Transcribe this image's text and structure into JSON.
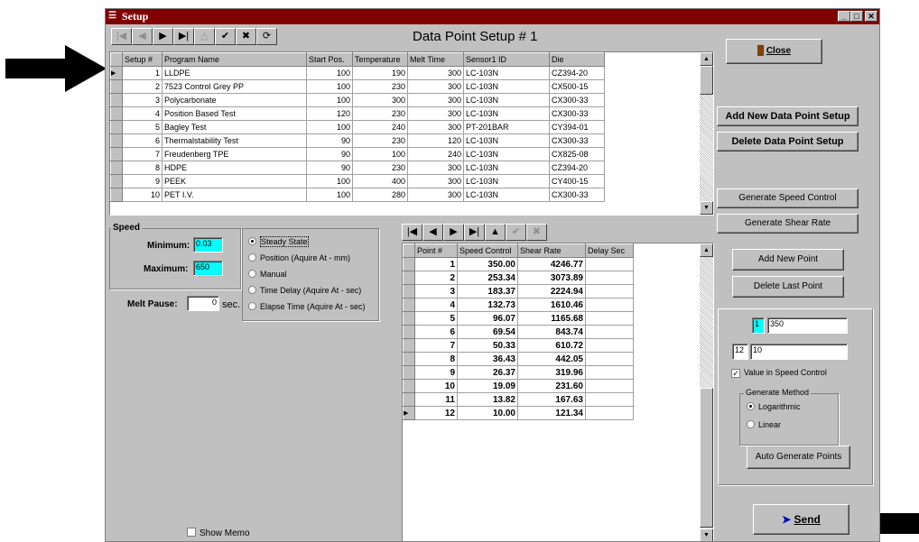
{
  "window": {
    "title": "Setup",
    "form_title": "Data Point Setup # 1"
  },
  "setup_grid": {
    "columns": [
      "Setup #",
      "Program Name",
      "Start Pos.",
      "Temperature",
      "Melt Time",
      "Sensor1 ID",
      "Die"
    ],
    "rows": [
      [
        "1",
        "LLDPE",
        "100",
        "190",
        "300",
        "LC-103N",
        "CZ394-20"
      ],
      [
        "2",
        "7523 Control Grey PP",
        "100",
        "230",
        "300",
        "LC-103N",
        "CX500-15"
      ],
      [
        "3",
        "Polycarbonate",
        "100",
        "300",
        "300",
        "LC-103N",
        "CX300-33"
      ],
      [
        "4",
        "Position Based Test",
        "120",
        "230",
        "300",
        "LC-103N",
        "CX300-33"
      ],
      [
        "5",
        "Bagley Test",
        "100",
        "240",
        "300",
        "PT-201BAR",
        "CY394-01"
      ],
      [
        "6",
        "Thermalstability Test",
        "90",
        "230",
        "120",
        "LC-103N",
        "CX300-33"
      ],
      [
        "7",
        "Freudenberg TPE",
        "90",
        "100",
        "240",
        "LC-103N",
        "CX825-08"
      ],
      [
        "8",
        "HDPE",
        "90",
        "230",
        "300",
        "LC-103N",
        "CZ394-20"
      ],
      [
        "9",
        "PEEK",
        "100",
        "400",
        "300",
        "LC-103N",
        "CY400-15"
      ],
      [
        "10",
        "PET I.V.",
        "100",
        "280",
        "300",
        "LC-103N",
        "CX300-33"
      ]
    ]
  },
  "buttons": {
    "close": "Close",
    "add_setup": "Add New Data Point Setup",
    "delete_setup": "Delete Data Point Setup",
    "gen_speed": "Generate Speed Control",
    "gen_shear": "Generate Shear Rate",
    "add_point": "Add New Point",
    "delete_point": "Delete Last Point",
    "auto_gen": "Auto Generate Points",
    "send": "Send"
  },
  "speed": {
    "group_label": "Speed",
    "min_label": "Minimum:",
    "min_value": "0.03",
    "max_label": "Maximum:",
    "max_value": "650",
    "melt_pause_label": "Melt Pause:",
    "melt_pause_value": "0",
    "melt_pause_unit": "sec."
  },
  "mode_options": [
    "Steady State",
    "Position (Aquire At - mm)",
    "Manual",
    "Time Delay (Aquire At - sec)",
    "Elapse Time (Aquire At - sec)"
  ],
  "mode_selected": "Steady State",
  "points_grid": {
    "columns": [
      "Point #",
      "Speed Control",
      "Shear Rate",
      "Delay Sec"
    ],
    "rows": [
      [
        "1",
        "350.00",
        "4246.77",
        ""
      ],
      [
        "2",
        "253.34",
        "3073.89",
        ""
      ],
      [
        "3",
        "183.37",
        "2224.94",
        ""
      ],
      [
        "4",
        "132.73",
        "1610.46",
        ""
      ],
      [
        "5",
        "96.07",
        "1165.68",
        ""
      ],
      [
        "6",
        "69.54",
        "843.74",
        ""
      ],
      [
        "7",
        "50.33",
        "610.72",
        ""
      ],
      [
        "8",
        "36.43",
        "442.05",
        ""
      ],
      [
        "9",
        "26.37",
        "319.96",
        ""
      ],
      [
        "10",
        "19.09",
        "231.60",
        ""
      ],
      [
        "11",
        "13.82",
        "167.63",
        ""
      ],
      [
        "12",
        "10.00",
        "121.34",
        ""
      ]
    ]
  },
  "generator": {
    "start_index": "1",
    "start_value": "350",
    "end_index": "12",
    "end_value": "10",
    "value_in_speed_label": "Value in Speed Control",
    "value_in_speed_checked": true,
    "method_label": "Generate Method",
    "methods": [
      "Logarithmic",
      "Linear"
    ],
    "method_selected": "Logarithmic"
  },
  "show_memo_label": "Show Memo",
  "colors": {
    "titlebar": "#800000",
    "window_bg": "#c0c0c0",
    "field_highlight": "#00ffff",
    "send_arrow": "#0000c0"
  }
}
